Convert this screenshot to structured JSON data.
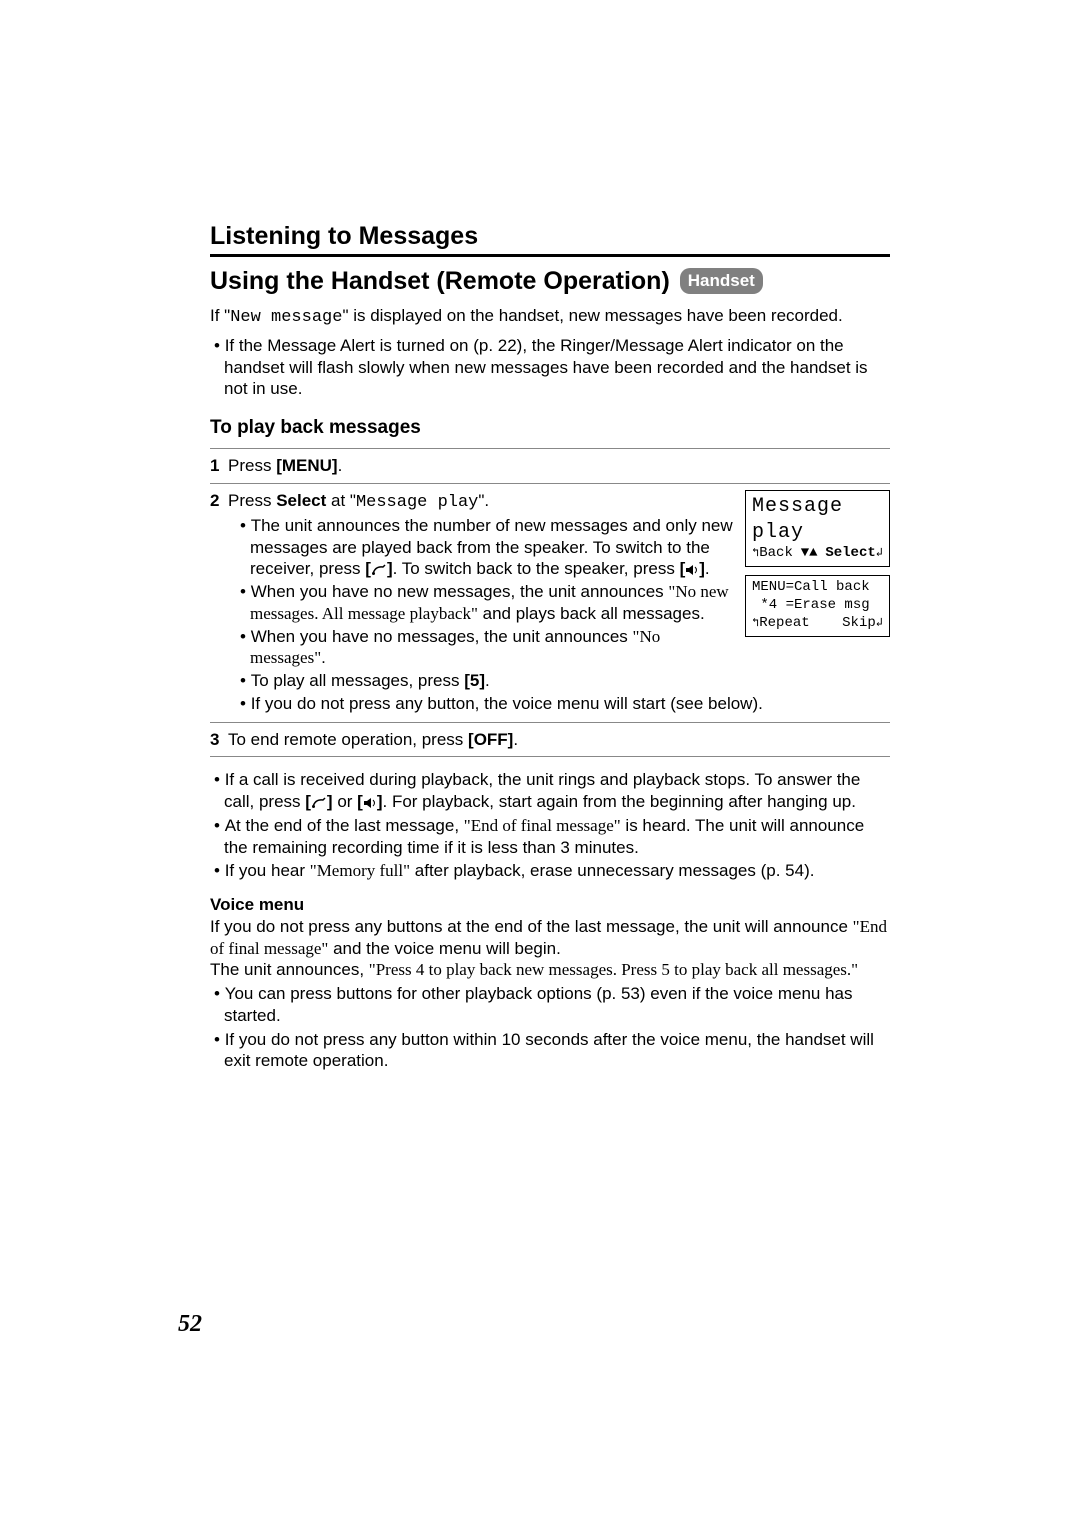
{
  "header": {
    "title": "Listening to Messages"
  },
  "section": {
    "title": "Using the Handset (Remote Operation)",
    "badge": "Handset"
  },
  "intro": {
    "pre": "If \"",
    "mono": "New message",
    "post": "\" is displayed on the handset, new messages have been recorded."
  },
  "alert_bullet": "If the Message Alert is turned on (p. 22), the Ringer/Message Alert indicator on the handset will flash slowly when new messages have been recorded and the handset is not in use.",
  "subhead": "To play back messages",
  "steps": [
    {
      "pre": "Press ",
      "bold": "[MENU]",
      "post": "."
    },
    {
      "pre": "Press ",
      "bold": "Select",
      "mid": " at \"",
      "mono": "Message play",
      "post": "\".",
      "bullets": [
        {
          "a": "The unit announces the number of new messages and only new messages are played back from the speaker. To switch to the receiver, press ",
          "bold1": "[",
          "icon": "talk",
          "bold2": "]",
          "b": ". To switch back to the speaker, press ",
          "bold3": "[",
          "icon2": "speaker",
          "bold4": "]",
          "c": "."
        },
        {
          "a": "When you have no new messages, the unit announces ",
          "serif": "\"No new messages. All message playback\"",
          "b": " and plays back all messages."
        },
        {
          "a": "When you have no messages, the unit announces ",
          "serif": "\"No messages\"",
          "b": "."
        },
        {
          "a": "To play all messages, press ",
          "bold1": "[5]",
          "b": "."
        },
        {
          "a": "If you do not press any button, the voice menu will start (see below)."
        }
      ]
    },
    {
      "pre": "To end remote operation, press ",
      "bold": "[OFF]",
      "post": "."
    }
  ],
  "lcd1": {
    "title": "Message play",
    "back": "Back",
    "select": "Select"
  },
  "lcd2": {
    "l1": "MENU=Call back",
    "l2": " *4 =Erase msg",
    "l3a": "Repeat",
    "l3b": "Skip"
  },
  "notes": [
    {
      "a": "If a call is received during playback, the unit rings and playback stops. To answer the call, press ",
      "bold1": "[",
      "icon": "talk",
      "bold2": "]",
      "mid": " or ",
      "bold3": "[",
      "icon2": "speaker",
      "bold4": "]",
      "b": ". For playback, start again from the beginning after hanging up."
    },
    {
      "a": "At the end of the last message, ",
      "serif": "\"End of final message\"",
      "b": " is heard. The unit will announce the remaining recording time if it is less than 3 minutes."
    },
    {
      "a": "If you hear ",
      "serif": "\"Memory full\"",
      "b": " after playback, erase unnecessary messages (p. 54)."
    }
  ],
  "voice": {
    "title": "Voice menu",
    "p1a": "If you do not press any buttons at the end of the last message, the unit will announce ",
    "p1serif": "\"End of final message\"",
    "p1b": " and the voice menu will begin.",
    "p2a": "The unit announces, ",
    "p2serif": "\"Press 4 to play back new messages. Press 5 to play back all messages.\"",
    "bullets": [
      "You can press buttons for other playback options (p. 53) even if the voice menu has started.",
      "If you do not press any button within 10 seconds after the voice menu, the handset will exit remote operation."
    ]
  },
  "page_number": "52"
}
